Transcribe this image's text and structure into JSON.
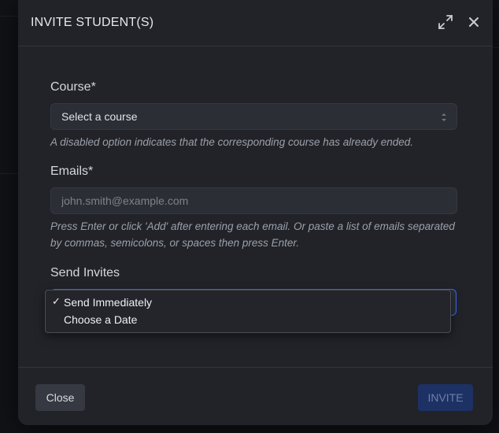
{
  "modal": {
    "title": "INVITE STUDENT(S)"
  },
  "course": {
    "label": "Course*",
    "selected": "Select a course",
    "help": "A disabled option indicates that the corresponding course has already ended."
  },
  "emails": {
    "label": "Emails*",
    "placeholder": "john.smith@example.com",
    "value": "",
    "help": "Press Enter or click 'Add' after entering each email. Or paste a list of emails separated by commas, semicolons, or spaces then press Enter."
  },
  "send_invites": {
    "label": "Send Invites",
    "options": [
      {
        "label": "Send Immediately",
        "selected": true,
        "check": "✓"
      },
      {
        "label": "Choose a Date",
        "selected": false,
        "check": ""
      }
    ]
  },
  "footer": {
    "close_label": "Close",
    "invite_label": "INVITE"
  },
  "icons": {
    "expand": "expand-icon",
    "close": "close-icon",
    "select_arrows": "select-arrows-icon"
  },
  "colors": {
    "modal_bg": "#212329",
    "accent": "#3a6df0",
    "invite_disabled_bg": "#1d3164"
  }
}
